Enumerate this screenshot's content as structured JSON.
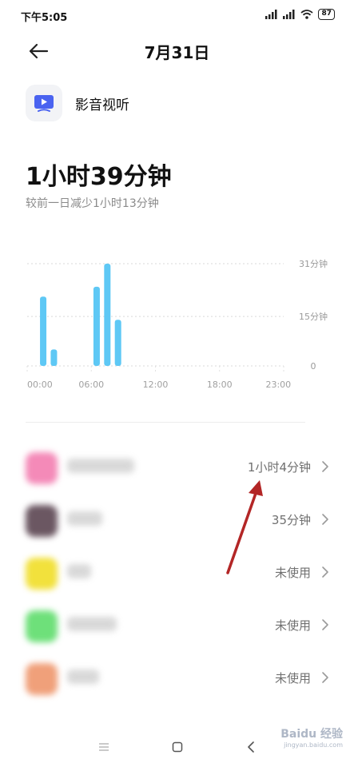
{
  "status_bar": {
    "time": "下午5:05",
    "battery": "87"
  },
  "header": {
    "title": "7月31日"
  },
  "app": {
    "name": "影音视听",
    "icon": "video-play-icon"
  },
  "summary": {
    "total": "1小时39分钟",
    "compare": "较前一日减少1小时13分钟"
  },
  "chart_data": {
    "type": "bar",
    "unit": "分钟",
    "x_tick_labels": [
      "00:00",
      "06:00",
      "12:00",
      "18:00",
      "23:00"
    ],
    "y_tick_labels": [
      "31分钟",
      "15分钟",
      "0"
    ],
    "ylim": [
      0,
      31
    ],
    "grid": true,
    "bar_color": "#5ec8f5",
    "bars": [
      {
        "hour": 1,
        "value": 21
      },
      {
        "hour": 2,
        "value": 5
      },
      {
        "hour": 6,
        "value": 24
      },
      {
        "hour": 7,
        "value": 31
      },
      {
        "hour": 8,
        "value": 14
      }
    ]
  },
  "list": {
    "items": [
      {
        "value": "1小时4分钟",
        "icon_color": "#f48ab8"
      },
      {
        "value": "35分钟",
        "icon_color": "#6b5762"
      },
      {
        "value": "未使用",
        "icon_color": "#f2e13c"
      },
      {
        "value": "未使用",
        "icon_color": "#6ee07a"
      },
      {
        "value": "未使用",
        "icon_color": "#f0a07a"
      }
    ]
  },
  "watermark": {
    "main": "Baidu 经验",
    "sub": "jingyan.baidu.com"
  }
}
